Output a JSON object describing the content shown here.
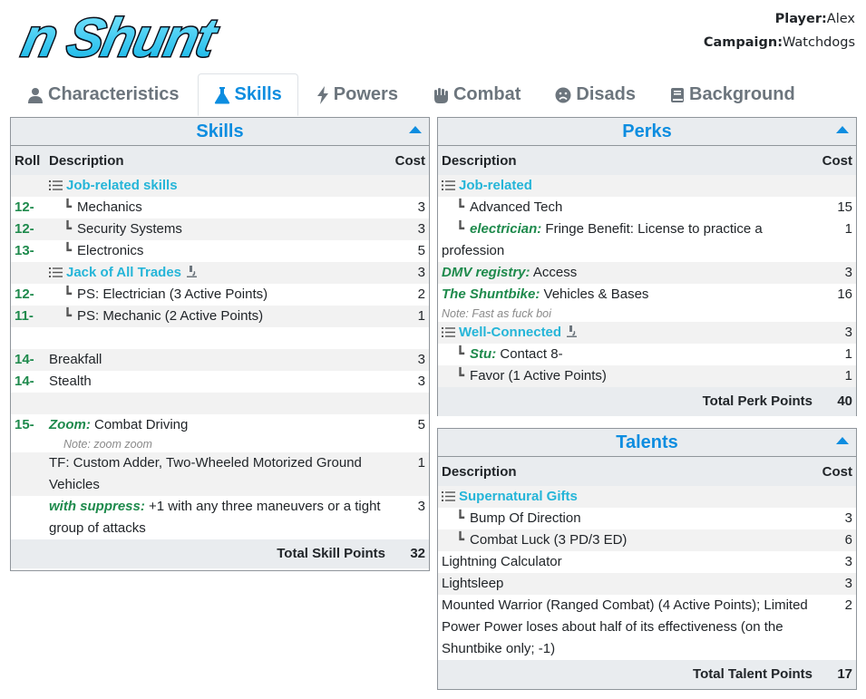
{
  "app": {
    "logo_text": "n Shunt"
  },
  "player": {
    "label": "Player:",
    "value": "Alex"
  },
  "campaign": {
    "label": "Campaign:",
    "value": "Watchdogs"
  },
  "tabs": [
    {
      "label": "Characteristics",
      "icon": "person-icon",
      "active": false
    },
    {
      "label": "Skills",
      "icon": "flask-icon",
      "active": true
    },
    {
      "label": "Powers",
      "icon": "bolt-icon",
      "active": false
    },
    {
      "label": "Combat",
      "icon": "fist-icon",
      "active": false
    },
    {
      "label": "Disads",
      "icon": "frown-icon",
      "active": false
    },
    {
      "label": "Background",
      "icon": "book-icon",
      "active": false
    }
  ],
  "skills": {
    "title": "Skills",
    "columns": {
      "roll": "Roll",
      "description": "Description",
      "cost": "Cost"
    },
    "rows": {
      "r1": {
        "roll": "",
        "label": "Job-related skills",
        "cost": ""
      },
      "r2": {
        "roll": "12-",
        "label": "Mechanics",
        "cost": "3"
      },
      "r3": {
        "roll": "12-",
        "label": "Security Systems",
        "cost": "3"
      },
      "r4": {
        "roll": "13-",
        "label": "Electronics",
        "cost": "5"
      },
      "r5": {
        "roll": "",
        "label": "Jack of All Trades",
        "cost": "3"
      },
      "r6": {
        "roll": "12-",
        "label": "PS: Electrician (3 Active Points)",
        "cost": "2"
      },
      "r7": {
        "roll": "11-",
        "label": "PS: Mechanic (2 Active Points)",
        "cost": "1"
      },
      "r8": {
        "roll": "14-",
        "label": "Breakfall",
        "cost": "3"
      },
      "r9": {
        "roll": "14-",
        "label": "Stealth",
        "cost": "3"
      },
      "r10": {
        "roll": "15-",
        "name": "Zoom:",
        "label": "Combat Driving",
        "note": "Note: zoom zoom",
        "cost": "5"
      },
      "r11": {
        "roll": "",
        "label": "TF: Custom Adder, Two-Wheeled Motorized Ground Vehicles",
        "cost": "1"
      },
      "r12": {
        "roll": "",
        "name": "with suppress:",
        "label": "+1 with any three maneuvers or a tight group of attacks",
        "cost": "3"
      }
    },
    "total_label": "Total Skill Points",
    "total": "32"
  },
  "perks": {
    "title": "Perks",
    "columns": {
      "description": "Description",
      "cost": "Cost"
    },
    "rows": {
      "p1": {
        "label": "Job-related",
        "cost": ""
      },
      "p2": {
        "label": "Advanced Tech",
        "cost": "15"
      },
      "p3": {
        "name": "electrician:",
        "label": "Fringe Benefit: License to practice a profession",
        "cost": "1"
      },
      "p4": {
        "name": "DMV registry:",
        "label": "Access",
        "cost": "3"
      },
      "p5": {
        "name": "The Shuntbike:",
        "label": "Vehicles & Bases",
        "note": "Note: Fast as fuck boi",
        "cost": "16"
      },
      "p6": {
        "label": "Well-Connected",
        "cost": "3"
      },
      "p7": {
        "name": "Stu:",
        "label": "Contact 8-",
        "cost": "1"
      },
      "p8": {
        "label": "Favor (1 Active Points)",
        "cost": "1"
      }
    },
    "total_label": "Total Perk Points",
    "total": "40"
  },
  "talents": {
    "title": "Talents",
    "columns": {
      "description": "Description",
      "cost": "Cost"
    },
    "rows": {
      "t1": {
        "label": "Supernatural Gifts",
        "cost": ""
      },
      "t2": {
        "label": "Bump Of Direction",
        "cost": "3"
      },
      "t3": {
        "label": "Combat Luck (3 PD/3 ED)",
        "cost": "6"
      },
      "t4": {
        "label": "Lightning Calculator",
        "cost": "3"
      },
      "t5": {
        "label": "Lightsleep",
        "cost": "3"
      },
      "t6": {
        "label": "Mounted Warrior (Ranged Combat) (4 Active Points); Limited Power Power loses about half of its effectiveness (on the Shuntbike only; -1)",
        "cost": "2"
      }
    },
    "total_label": "Total Talent Points",
    "total": "17"
  },
  "colors": {
    "accent": "#0d8de0",
    "group": "#25b5d8",
    "roll": "#1e8a4c",
    "logo": "#1ec8f0"
  }
}
